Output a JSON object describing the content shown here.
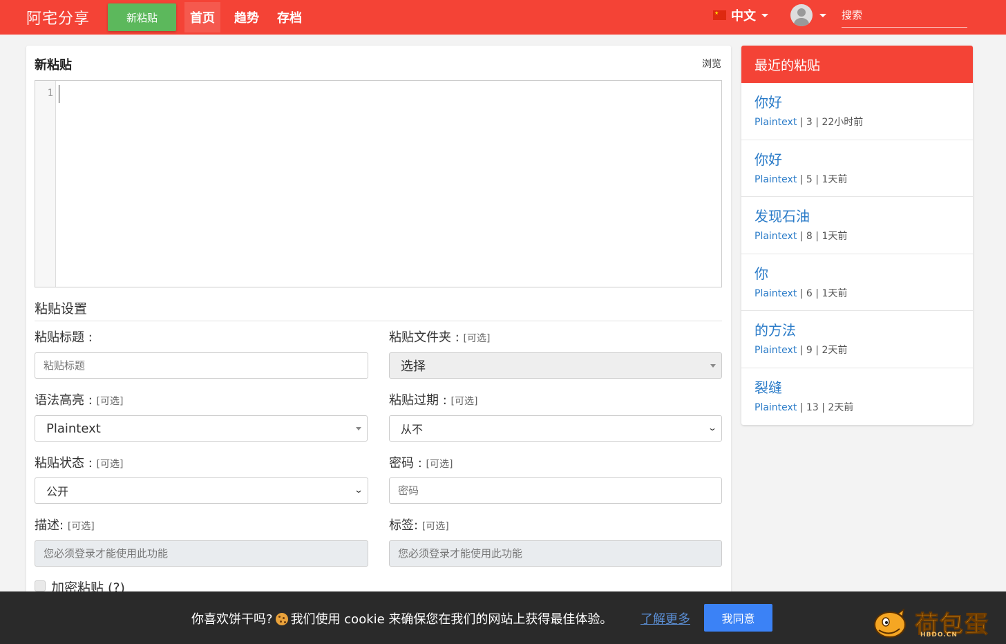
{
  "header": {
    "brand": "阿宅分享",
    "new_paste_button": "新粘贴",
    "nav": [
      "首页",
      "趋势",
      "存档"
    ],
    "language": "中文",
    "search_placeholder": "搜索"
  },
  "main": {
    "title": "新粘贴",
    "browse_link": "浏览",
    "editor_line_number": "1",
    "settings_title": "粘贴设置",
    "optional_tag": "[可选]",
    "fields": {
      "paste_title": {
        "label": "粘贴标题 :",
        "placeholder": "粘贴标题"
      },
      "folder": {
        "label": "粘贴文件夹 :",
        "value": "选择"
      },
      "syntax": {
        "label": "语法高亮 :",
        "value": "Plaintext"
      },
      "expiry": {
        "label": "粘贴过期 :",
        "value": "从不"
      },
      "status": {
        "label": "粘贴状态 :",
        "value": "公开"
      },
      "password": {
        "label": "密码 :",
        "placeholder": "密码"
      },
      "description": {
        "label": "描述:",
        "placeholder": "您必须登录才能使用此功能"
      },
      "tags": {
        "label": "标签:",
        "placeholder": "您必须登录才能使用此功能"
      }
    },
    "encrypt_label": "加密粘贴 (?)"
  },
  "sidebar": {
    "title": "最近的粘贴",
    "items": [
      {
        "title": "你好",
        "lang": "Plaintext",
        "meta": " | 3 | 22小时前"
      },
      {
        "title": "你好",
        "lang": "Plaintext",
        "meta": " | 5 | 1天前"
      },
      {
        "title": "发现石油",
        "lang": "Plaintext",
        "meta": " | 8 | 1天前"
      },
      {
        "title": "你",
        "lang": "Plaintext",
        "meta": " | 6 | 1天前"
      },
      {
        "title": "的方法",
        "lang": "Plaintext",
        "meta": " | 9 | 2天前"
      },
      {
        "title": "裂缝",
        "lang": "Plaintext",
        "meta": " | 13 | 2天前"
      }
    ]
  },
  "cookie_bar": {
    "text_before": "你喜欢饼干吗?",
    "text_after": "我们使用 cookie 来确保您在我们的网站上获得最佳体验。",
    "learn_more": "了解更多",
    "agree": "我同意"
  },
  "watermark": {
    "text": "荷包蛋",
    "sub": "HBDO.CN"
  },
  "colors": {
    "primary": "#f44336",
    "success": "#5cb85c",
    "link": "#2a7bc8",
    "cookie_bg": "#2a2a2a",
    "agree": "#3b82f6"
  }
}
